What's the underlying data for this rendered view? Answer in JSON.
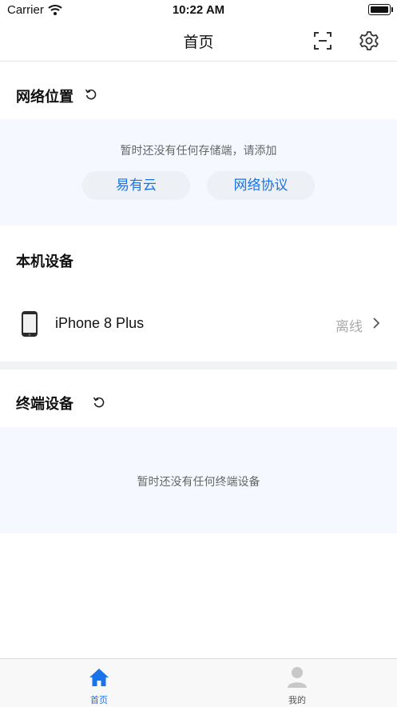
{
  "status_bar": {
    "carrier": "Carrier",
    "time": "10:22 AM"
  },
  "nav": {
    "title": "首页"
  },
  "network": {
    "title": "网络位置",
    "empty_hint": "暂时还没有任何存储端，请添加",
    "buttons": [
      "易有云",
      "网络协议"
    ]
  },
  "local": {
    "title": "本机设备",
    "device_name": "iPhone 8 Plus",
    "device_status": "离线"
  },
  "terminal": {
    "title": "终端设备",
    "empty_hint": "暂时还没有任何终端设备"
  },
  "tabs": [
    {
      "label": "首页",
      "icon": "home-icon",
      "active": true
    },
    {
      "label": "我的",
      "icon": "person-icon",
      "active": false
    }
  ],
  "colors": {
    "accent": "#1a73e8",
    "panel": "#f5f9ff",
    "muted": "#aaaaaa"
  }
}
